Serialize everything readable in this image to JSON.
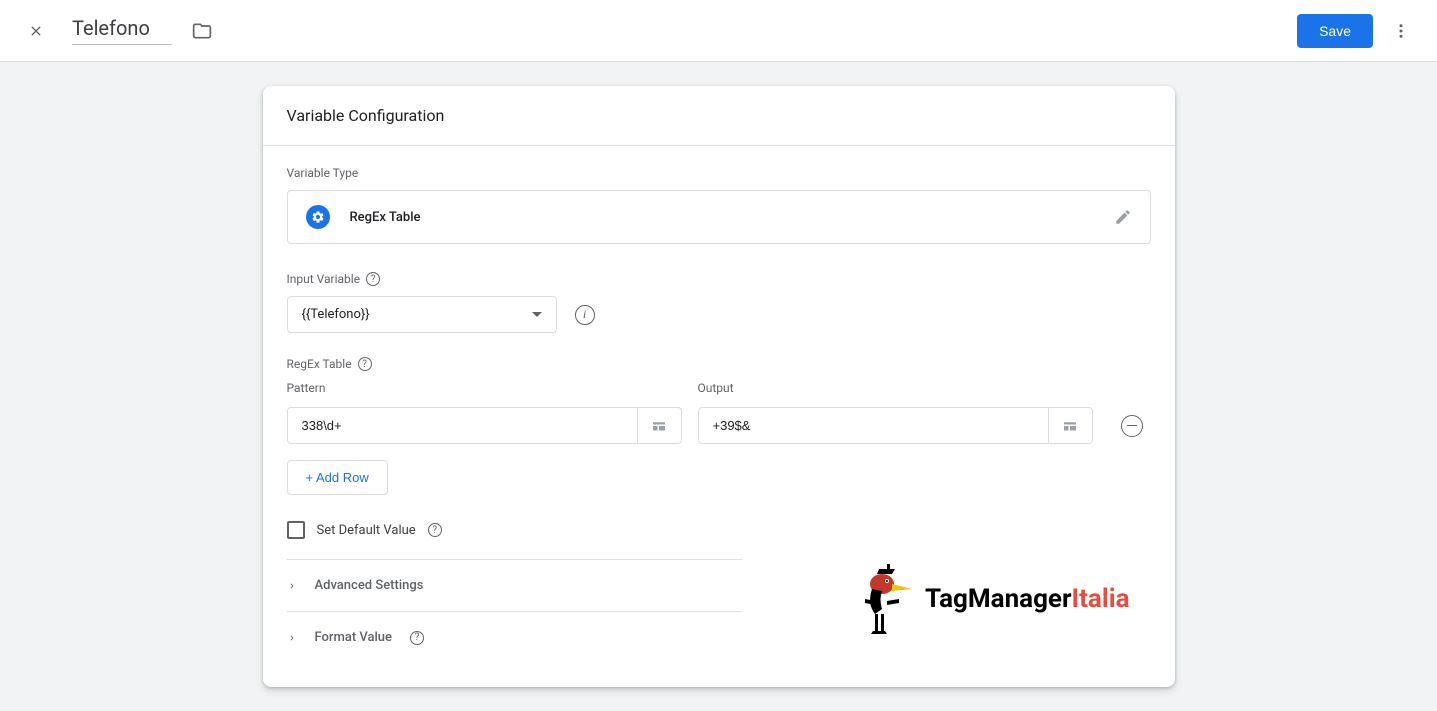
{
  "header": {
    "title": "Telefono",
    "save_label": "Save"
  },
  "card": {
    "title": "Variable Configuration",
    "variable_type_label": "Variable Type",
    "variable_type_name": "RegEx Table",
    "input_variable_label": "Input Variable",
    "input_variable_value": "{{Telefono}}",
    "regex_table_label": "RegEx Table",
    "pattern_label": "Pattern",
    "output_label": "Output",
    "rows": [
      {
        "pattern": "338\\d+",
        "output": "+39$&"
      }
    ],
    "add_row_label": "+ Add Row",
    "set_default_label": "Set Default Value",
    "advanced_label": "Advanced Settings",
    "format_label": "Format Value"
  },
  "logo": {
    "part1": "TagManager",
    "part2": "Italia"
  }
}
